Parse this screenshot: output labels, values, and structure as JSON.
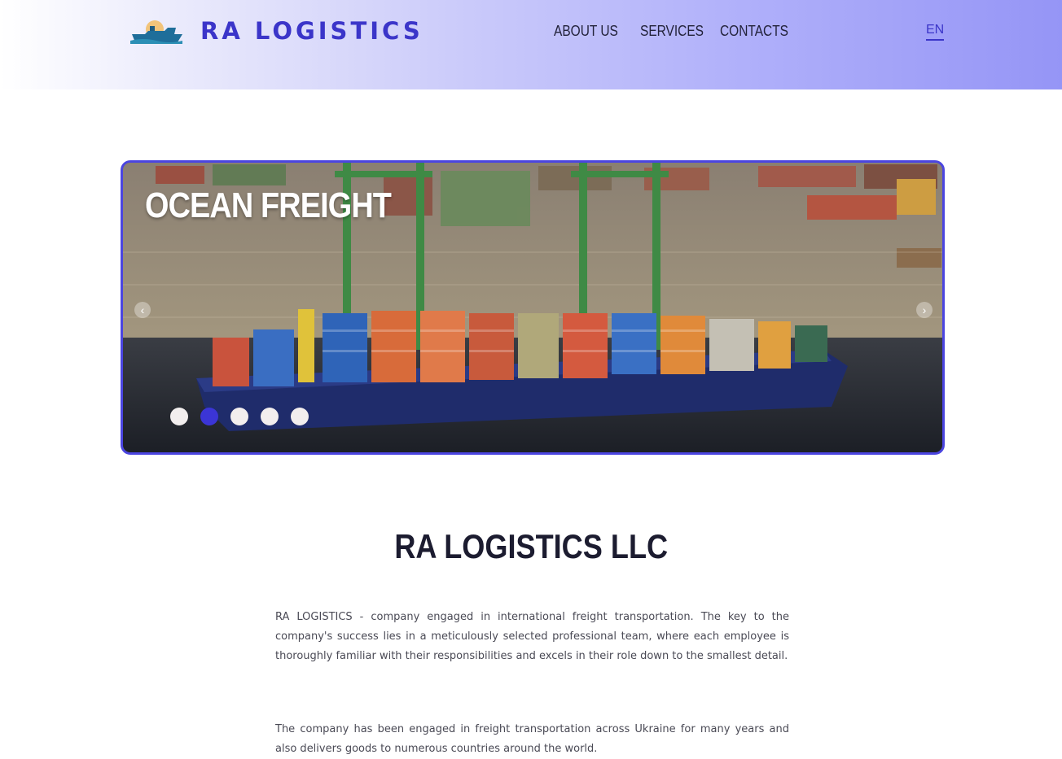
{
  "header": {
    "logo_text": "RA LOGISTICS",
    "nav": [
      "ABOUT US",
      "SERVICES",
      "CONTACTS"
    ],
    "language": "EN"
  },
  "slider": {
    "title": "OCEAN FREIGHT",
    "prev_arrow": "‹",
    "next_arrow": "›",
    "slide_count": 5,
    "active_slide": 2
  },
  "about": {
    "title": "RA LOGISTICS LLC",
    "paragraph1": "RA LOGISTICS - company engaged in international freight transportation. The key to the company's success lies in a meticulously selected professional team, where each employee is thoroughly familiar with their responsibilities and excels in their role down to the smallest detail.",
    "paragraph2": "The company has been engaged in freight transportation across Ukraine for many years and also delivers goods to numerous countries around the world."
  },
  "colors": {
    "accent": "#3b35c9",
    "slider_border": "#4b45e0",
    "active_dot": "#3b35d6"
  }
}
